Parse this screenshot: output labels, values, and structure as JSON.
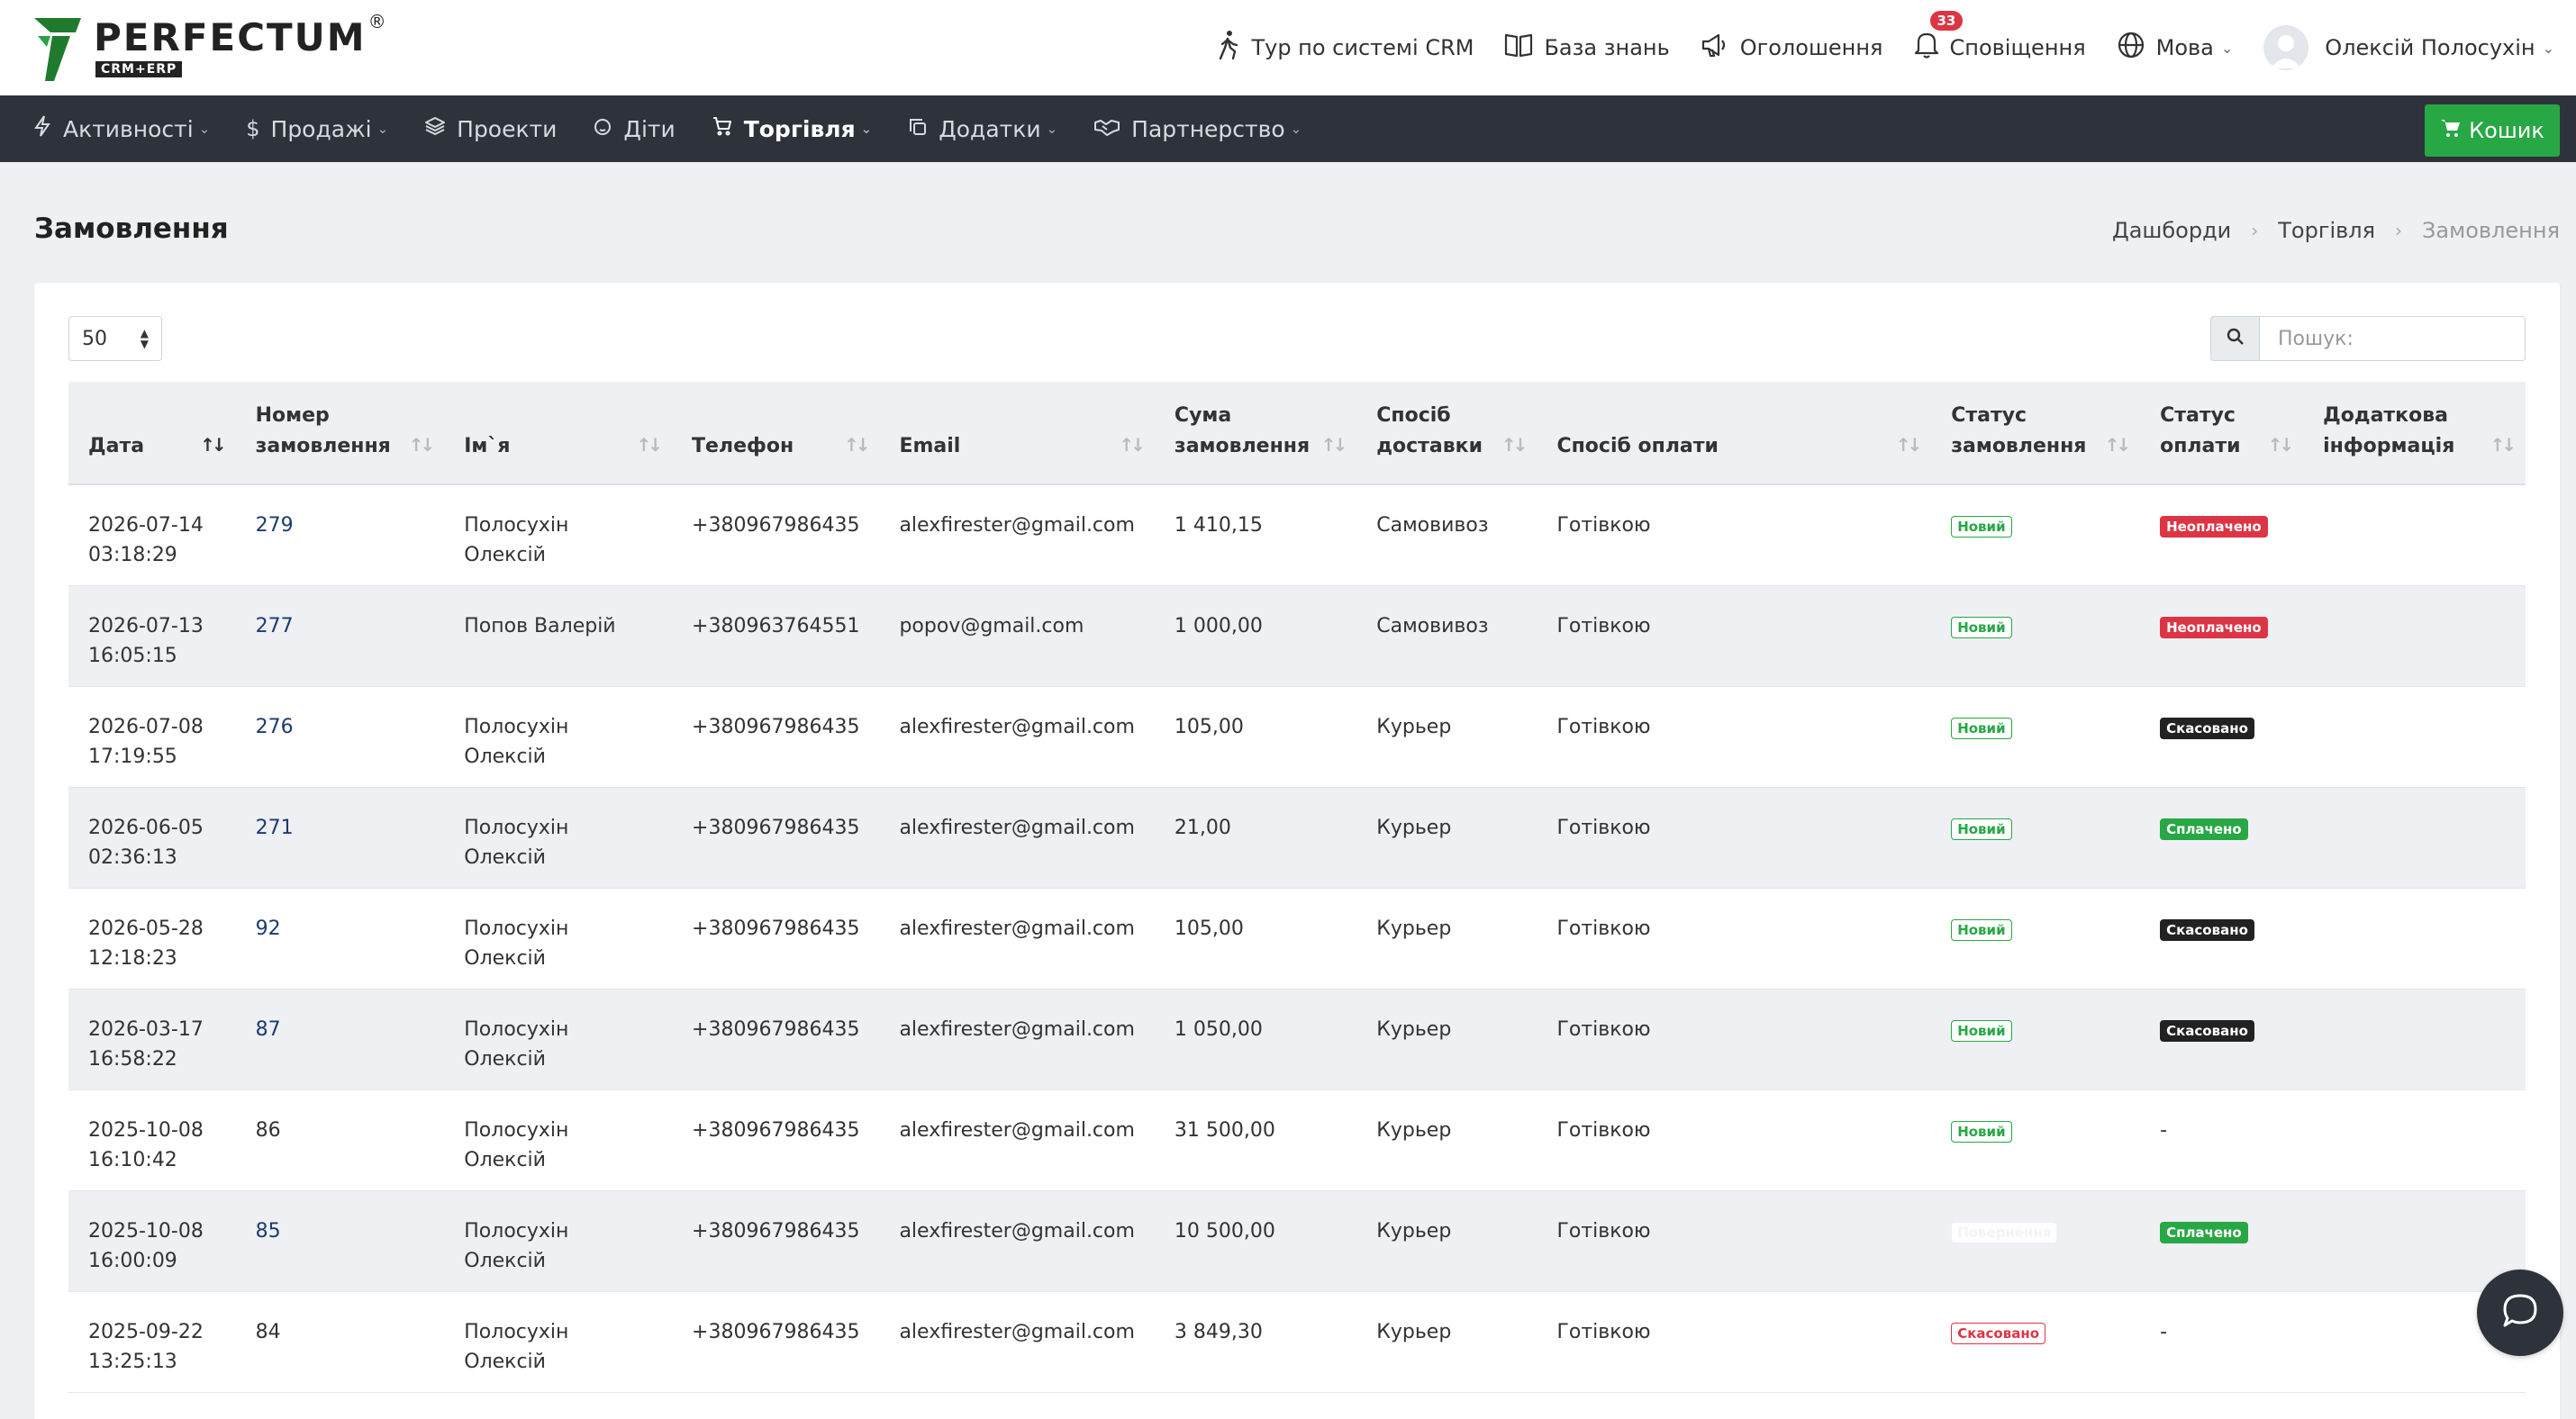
{
  "brand": {
    "name": "PERFECTUM",
    "reg": "®",
    "sub": "CRM+ERP"
  },
  "top_nav": {
    "tour": "Тур по системі CRM",
    "knowledge": "База знань",
    "announcements": "Оголошення",
    "notifications": "Сповіщення",
    "notifications_count": "33",
    "language": "Мова",
    "user": "Олексій Полосухін"
  },
  "main_nav": {
    "items": [
      {
        "label": "Активності"
      },
      {
        "label": "Продажі"
      },
      {
        "label": "Проекти"
      },
      {
        "label": "Діти"
      },
      {
        "label": "Торгівля"
      },
      {
        "label": "Додатки"
      },
      {
        "label": "Партнерство"
      }
    ],
    "cart": "Кошик"
  },
  "page": {
    "title": "Замовлення",
    "breadcrumb": [
      "Дашборди",
      "Торгівля",
      "Замовлення"
    ]
  },
  "table_controls": {
    "page_length": "50",
    "search_placeholder": "Пошук:"
  },
  "columns": [
    "Дата",
    "Номер замовлення",
    "Ім`я",
    "Телефон",
    "Email",
    "Сума замовлення",
    "Спосіб доставки",
    "Спосіб оплати",
    "Статус замовлення",
    "Статус оплати",
    "Додаткова інформація"
  ],
  "rows": [
    {
      "date": "2026-07-14",
      "time": "03:18:29",
      "num": "279",
      "link": true,
      "name": "Полосухін Олексій",
      "phone": "+380967986435",
      "email": "alexfirester@gmail.com",
      "sum": "1 410,15",
      "delivery": "Самовивоз",
      "payment": "Готівкою",
      "order_status": "Новий",
      "order_status_style": "new",
      "pay_status": "Неоплачено",
      "pay_status_style": "unpaid",
      "extra": ""
    },
    {
      "date": "2026-07-13",
      "time": "16:05:15",
      "num": "277",
      "link": true,
      "name": "Попов Валерій",
      "phone": "+380963764551",
      "email": "popov@gmail.com",
      "sum": "1 000,00",
      "delivery": "Самовивоз",
      "payment": "Готівкою",
      "order_status": "Новий",
      "order_status_style": "new",
      "pay_status": "Неоплачено",
      "pay_status_style": "unpaid",
      "extra": ""
    },
    {
      "date": "2026-07-08",
      "time": "17:19:55",
      "num": "276",
      "link": true,
      "name": "Полосухін Олексій",
      "phone": "+380967986435",
      "email": "alexfirester@gmail.com",
      "sum": "105,00",
      "delivery": "Курьер",
      "payment": "Готівкою",
      "order_status": "Новий",
      "order_status_style": "new",
      "pay_status": "Скасовано",
      "pay_status_style": "cancel-dark",
      "extra": ""
    },
    {
      "date": "2026-06-05",
      "time": "02:36:13",
      "num": "271",
      "link": true,
      "name": "Полосухін Олексій",
      "phone": "+380967986435",
      "email": "alexfirester@gmail.com",
      "sum": "21,00",
      "delivery": "Курьер",
      "payment": "Готівкою",
      "order_status": "Новий",
      "order_status_style": "new",
      "pay_status": "Сплачено",
      "pay_status_style": "paid",
      "extra": ""
    },
    {
      "date": "2026-05-28",
      "time": "12:18:23",
      "num": "92",
      "link": true,
      "name": "Полосухін Олексій",
      "phone": "+380967986435",
      "email": "alexfirester@gmail.com",
      "sum": "105,00",
      "delivery": "Курьер",
      "payment": "Готівкою",
      "order_status": "Новий",
      "order_status_style": "new",
      "pay_status": "Скасовано",
      "pay_status_style": "cancel-dark",
      "extra": ""
    },
    {
      "date": "2026-03-17",
      "time": "16:58:22",
      "num": "87",
      "link": true,
      "name": "Полосухін Олексій",
      "phone": "+380967986435",
      "email": "alexfirester@gmail.com",
      "sum": "1 050,00",
      "delivery": "Курьер",
      "payment": "Готівкою",
      "order_status": "Новий",
      "order_status_style": "new",
      "pay_status": "Скасовано",
      "pay_status_style": "cancel-dark",
      "extra": ""
    },
    {
      "date": "2025-10-08",
      "time": "16:10:42",
      "num": "86",
      "link": false,
      "name": "Полосухін Олексій",
      "phone": "+380967986435",
      "email": "alexfirester@gmail.com",
      "sum": "31 500,00",
      "delivery": "Курьер",
      "payment": "Готівкою",
      "order_status": "Новий",
      "order_status_style": "new",
      "pay_status": "-",
      "pay_status_style": "none",
      "extra": ""
    },
    {
      "date": "2025-10-08",
      "time": "16:00:09",
      "num": "85",
      "link": true,
      "name": "Полосухін Олексій",
      "phone": "+380967986435",
      "email": "alexfirester@gmail.com",
      "sum": "10 500,00",
      "delivery": "Курьер",
      "payment": "Готівкою",
      "order_status": "Повернення",
      "order_status_style": "returned",
      "pay_status": "Сплачено",
      "pay_status_style": "paid",
      "extra": ""
    },
    {
      "date": "2025-09-22",
      "time": "13:25:13",
      "num": "84",
      "link": false,
      "name": "Полосухін Олексій",
      "phone": "+380967986435",
      "email": "alexfirester@gmail.com",
      "sum": "3 849,30",
      "delivery": "Курьер",
      "payment": "Готівкою",
      "order_status": "Скасовано",
      "order_status_style": "cancel-red",
      "pay_status": "-",
      "pay_status_style": "none",
      "extra": ""
    }
  ]
}
